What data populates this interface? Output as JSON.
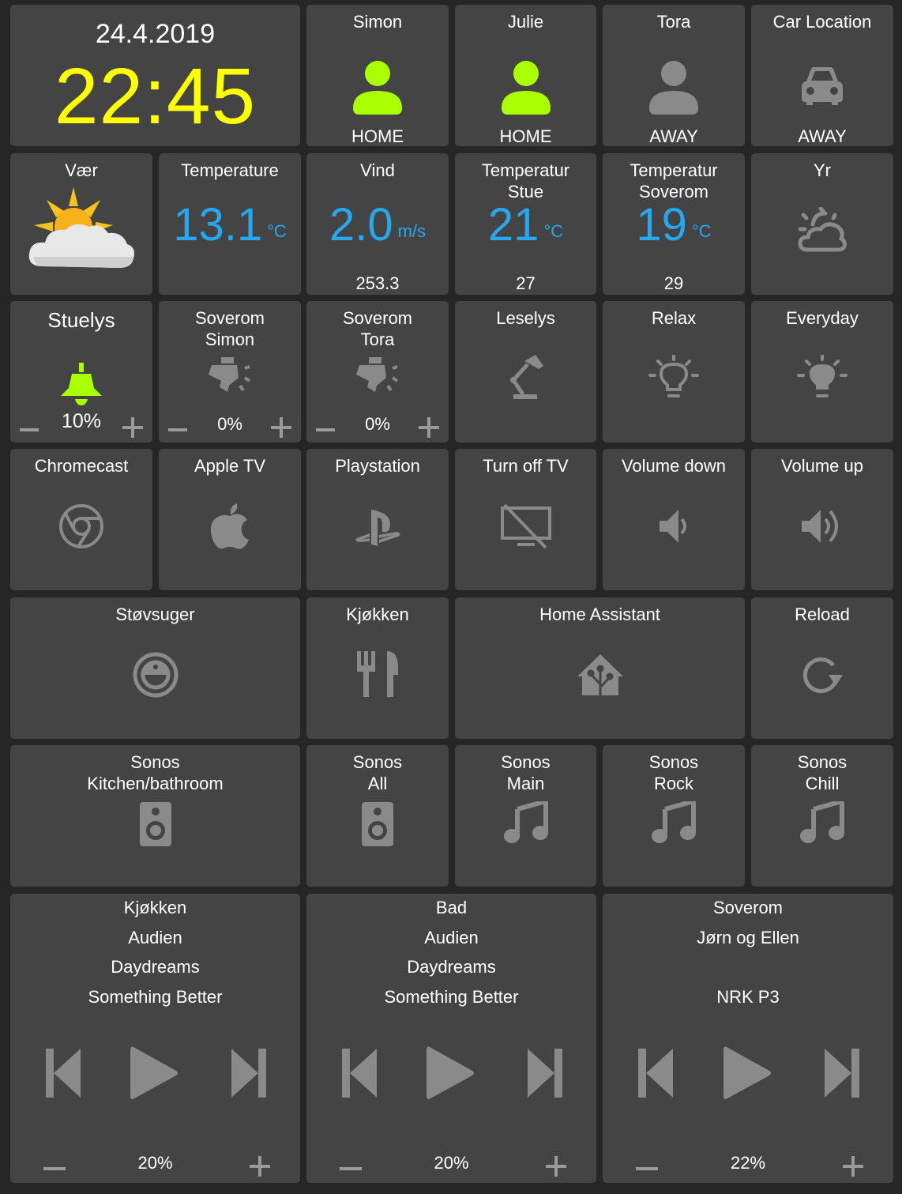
{
  "clock": {
    "date": "24.4.2019",
    "time": "22:45"
  },
  "persons": [
    {
      "name": "Simon",
      "state": "HOME",
      "color": "#aaff00"
    },
    {
      "name": "Julie",
      "state": "HOME",
      "color": "#aaff00"
    },
    {
      "name": "Tora",
      "state": "AWAY",
      "color": "#8a8a8a"
    }
  ],
  "car": {
    "name": "Car Location",
    "state": "AWAY",
    "icon": "car-icon"
  },
  "weather": {
    "var": {
      "title": "Vær",
      "icon": "partly-cloudy-sun-icon"
    },
    "temperature": {
      "title": "Temperature",
      "value": "13.1",
      "unit": "°C"
    },
    "vind": {
      "title": "Vind",
      "value": "2.0",
      "unit": "m/s",
      "sub": "253.3"
    },
    "stue": {
      "title_l1": "Temperatur",
      "title_l2": "Stue",
      "value": "21",
      "unit": "°C",
      "sub": "27"
    },
    "soverom": {
      "title_l1": "Temperatur",
      "title_l2": "Soverom",
      "value": "19",
      "unit": "°C",
      "sub": "29"
    },
    "yr": {
      "title": "Yr",
      "icon": "night-cloudy-icon"
    }
  },
  "lights": {
    "stuelys": {
      "title": "Stuelys",
      "pct": "10%",
      "icon": "ceiling-light-icon",
      "color": "#aaff00"
    },
    "soverom_simon": {
      "title_l1": "Soverom",
      "title_l2": "Simon",
      "pct": "0%",
      "icon": "spotlight-icon"
    },
    "soverom_tora": {
      "title_l1": "Soverom",
      "title_l2": "Tora",
      "pct": "0%",
      "icon": "spotlight-icon"
    },
    "leselys": {
      "title": "Leselys",
      "icon": "desk-lamp-icon"
    },
    "relax": {
      "title": "Relax",
      "icon": "lightbulb-outline-icon"
    },
    "everyday": {
      "title": "Everyday",
      "icon": "lightbulb-icon"
    }
  },
  "media_buttons": [
    {
      "title": "Chromecast",
      "icon": "chrome-icon"
    },
    {
      "title": "Apple TV",
      "icon": "apple-icon"
    },
    {
      "title": "Playstation",
      "icon": "playstation-icon"
    },
    {
      "title": "Turn off TV",
      "icon": "tv-off-icon"
    },
    {
      "title": "Volume down",
      "icon": "volume-low-icon"
    },
    {
      "title": "Volume up",
      "icon": "volume-high-icon"
    }
  ],
  "row5": {
    "stovsuger": {
      "title": "Støvsuger",
      "icon": "robot-vacuum-icon"
    },
    "kjokken": {
      "title": "Kjøkken",
      "icon": "fork-knife-icon"
    },
    "home_assistant": {
      "title": "Home Assistant",
      "icon": "home-assistant-icon"
    },
    "reload": {
      "title": "Reload",
      "icon": "reload-icon"
    }
  },
  "sonos": [
    {
      "title_l1": "Sonos",
      "title_l2": "Kitchen/bathroom",
      "icon": "speaker-icon"
    },
    {
      "title_l1": "Sonos",
      "title_l2": "All",
      "icon": "speaker-icon"
    },
    {
      "title_l1": "Sonos",
      "title_l2": "Main",
      "icon": "music-note-icon"
    },
    {
      "title_l1": "Sonos",
      "title_l2": "Rock",
      "icon": "music-note-icon"
    },
    {
      "title_l1": "Sonos",
      "title_l2": "Chill",
      "icon": "music-note-icon"
    }
  ],
  "players": [
    {
      "room": "Kjøkken",
      "artist": "Audien",
      "album": "Daydreams",
      "track": "Something Better",
      "volume": "20%"
    },
    {
      "room": "Bad",
      "artist": "Audien",
      "album": "Daydreams",
      "track": "Something Better",
      "volume": "20%"
    },
    {
      "room": "Soverom",
      "artist": "Jørn og Ellen",
      "album": "",
      "track": "NRK P3",
      "volume": "22%"
    }
  ],
  "colors": {
    "accent_green": "#aaff00",
    "clock_yellow": "#ffff00",
    "sensor_blue": "#25a8f0",
    "tile": "#444444",
    "background": "#262626",
    "icon_gray": "#8a8a8a"
  }
}
